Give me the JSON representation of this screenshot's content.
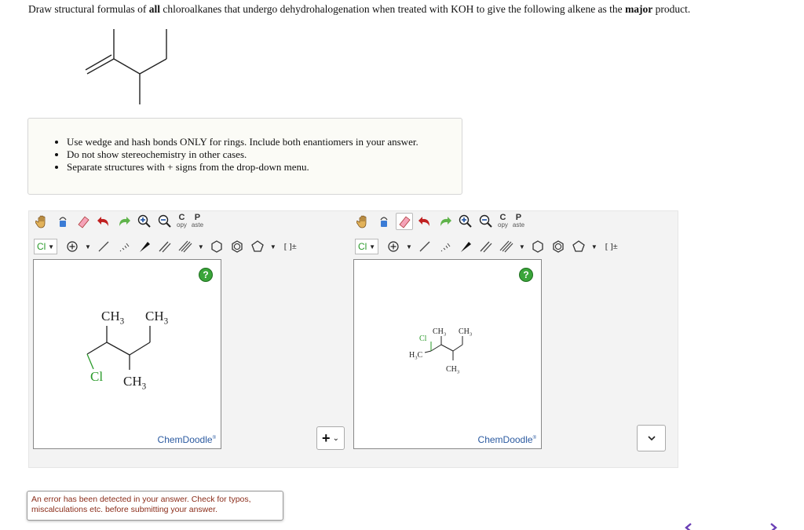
{
  "question": {
    "part1": "Draw structural formulas of ",
    "bold1": "all",
    "part2": " chloroalkanes that undergo dehydrohalogenation when treated with KOH to give the following alkene as the ",
    "bold2": "major",
    "part3": " product."
  },
  "instructions": [
    "Use wedge and hash bonds ONLY for rings. Include both enantiomers in your answer.",
    "Do not show stereochemistry in other cases.",
    "Separate structures with + signs from the drop-down menu."
  ],
  "toolbar": {
    "copy_big": "C",
    "copy_small": "opy",
    "paste_big": "P",
    "paste_small": "aste",
    "element": "Cl",
    "charge_label": "[ ]±"
  },
  "editor1": {
    "labels": {
      "ch3_a": "CH3",
      "ch3_b": "CH3",
      "cl": "Cl",
      "ch3_c": "CH3"
    },
    "help": "?",
    "brand": "ChemDoodle"
  },
  "editor2": {
    "labels": {
      "ch3_a": "CH3",
      "ch3_b": "CH3",
      "cl": "Cl",
      "h3c": "H3C",
      "ch3_c": "CH3"
    },
    "help": "?",
    "brand": "ChemDoodle"
  },
  "separator_select": {
    "value": "+"
  },
  "error_message": "An error has been detected in your answer. Check for typos, miscalculations etc. before submitting your answer.",
  "colors": {
    "accent_green": "#3aa53a",
    "error_text": "#8b2d1a",
    "nav_purple": "#6a3fb5",
    "chlorine_green": "#2a9a2a"
  }
}
